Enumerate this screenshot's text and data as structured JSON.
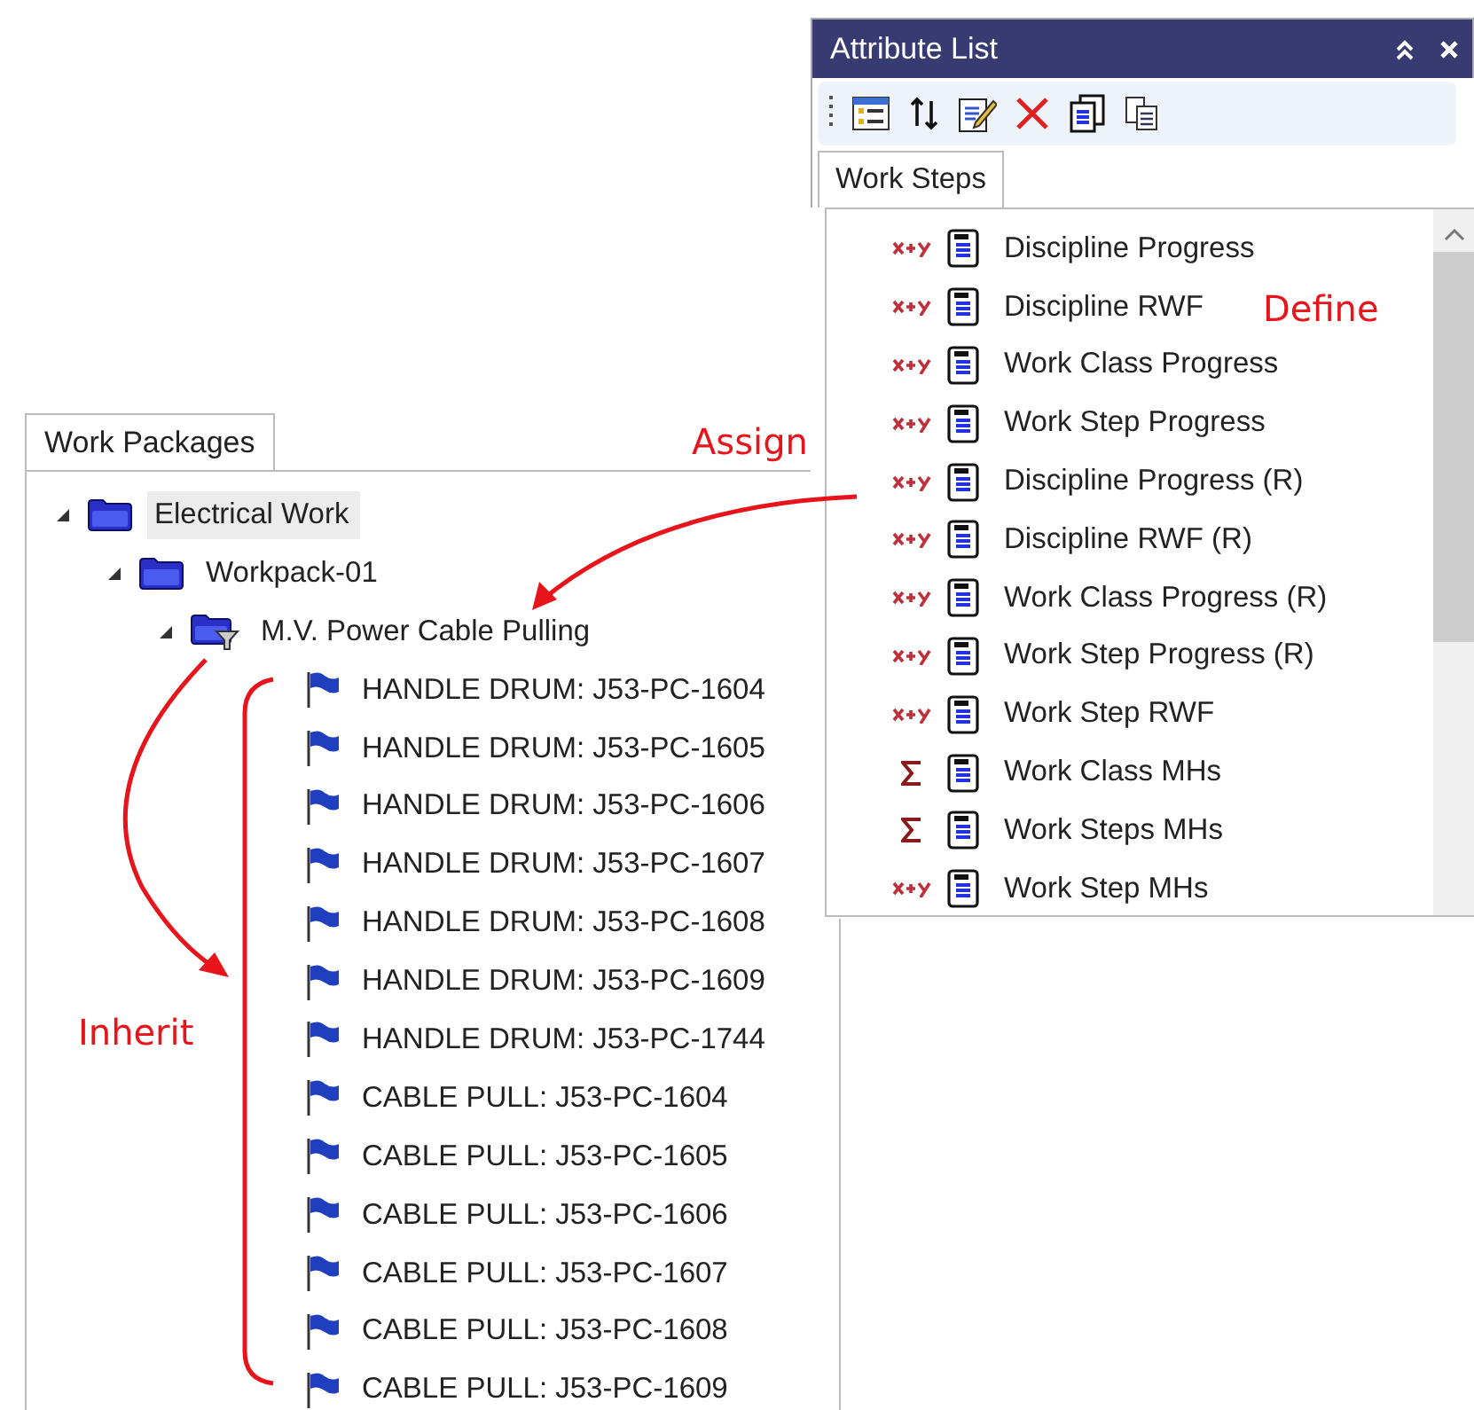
{
  "work_packages": {
    "tabs": [
      {
        "label": "Work Packages",
        "selected": true
      }
    ],
    "tree": [
      {
        "label": "Electrical Work",
        "kind": "folder",
        "expanded": true,
        "selected": true,
        "children": [
          {
            "label": "Workpack-01",
            "kind": "folder",
            "expanded": true,
            "selected": false,
            "children": [
              {
                "label": "M.V. Power Cable Pulling",
                "kind": "filter-folder",
                "expanded": true,
                "selected": false,
                "children": [
                  {
                    "label": "HANDLE DRUM: J53-PC-1604",
                    "kind": "flag",
                    "selected": false
                  },
                  {
                    "label": "HANDLE DRUM: J53-PC-1605",
                    "kind": "flag",
                    "selected": false
                  },
                  {
                    "label": "HANDLE DRUM: J53-PC-1606",
                    "kind": "flag",
                    "selected": false
                  },
                  {
                    "label": "HANDLE DRUM: J53-PC-1607",
                    "kind": "flag",
                    "selected": false
                  },
                  {
                    "label": "HANDLE DRUM: J53-PC-1608",
                    "kind": "flag",
                    "selected": false
                  },
                  {
                    "label": "HANDLE DRUM: J53-PC-1609",
                    "kind": "flag",
                    "selected": false
                  },
                  {
                    "label": "HANDLE DRUM: J53-PC-1744",
                    "kind": "flag",
                    "selected": false
                  },
                  {
                    "label": "CABLE PULL: J53-PC-1604",
                    "kind": "flag",
                    "selected": false
                  },
                  {
                    "label": "CABLE PULL: J53-PC-1605",
                    "kind": "flag",
                    "selected": false
                  },
                  {
                    "label": "CABLE PULL: J53-PC-1606",
                    "kind": "flag",
                    "selected": false
                  },
                  {
                    "label": "CABLE PULL: J53-PC-1607",
                    "kind": "flag",
                    "selected": false
                  },
                  {
                    "label": "CABLE PULL: J53-PC-1608",
                    "kind": "flag",
                    "selected": false
                  },
                  {
                    "label": "CABLE PULL: J53-PC-1609",
                    "kind": "flag",
                    "selected": false
                  }
                ]
              }
            ]
          }
        ]
      }
    ]
  },
  "attribute_list": {
    "title": "Attribute List",
    "tabs": [
      {
        "label": "Work Steps",
        "selected": true
      }
    ],
    "items": [
      {
        "label": "Discipline Progress",
        "kind": "formula"
      },
      {
        "label": "Discipline RWF",
        "kind": "formula"
      },
      {
        "label": "Work Class Progress",
        "kind": "formula"
      },
      {
        "label": "Work Step Progress",
        "kind": "formula"
      },
      {
        "label": "Discipline Progress (R)",
        "kind": "formula"
      },
      {
        "label": "Discipline RWF (R)",
        "kind": "formula"
      },
      {
        "label": "Work Class Progress (R)",
        "kind": "formula"
      },
      {
        "label": "Work Step Progress (R)",
        "kind": "formula"
      },
      {
        "label": "Work Step RWF",
        "kind": "formula"
      },
      {
        "label": "Work Class MHs",
        "kind": "sum"
      },
      {
        "label": "Work Steps MHs",
        "kind": "sum"
      },
      {
        "label": "Work Step MHs",
        "kind": "formula"
      }
    ]
  },
  "annotations": [
    {
      "kind": "define",
      "text": "Define"
    },
    {
      "kind": "assign",
      "text": "Assign"
    },
    {
      "kind": "inherit",
      "text": "Inherit"
    }
  ]
}
